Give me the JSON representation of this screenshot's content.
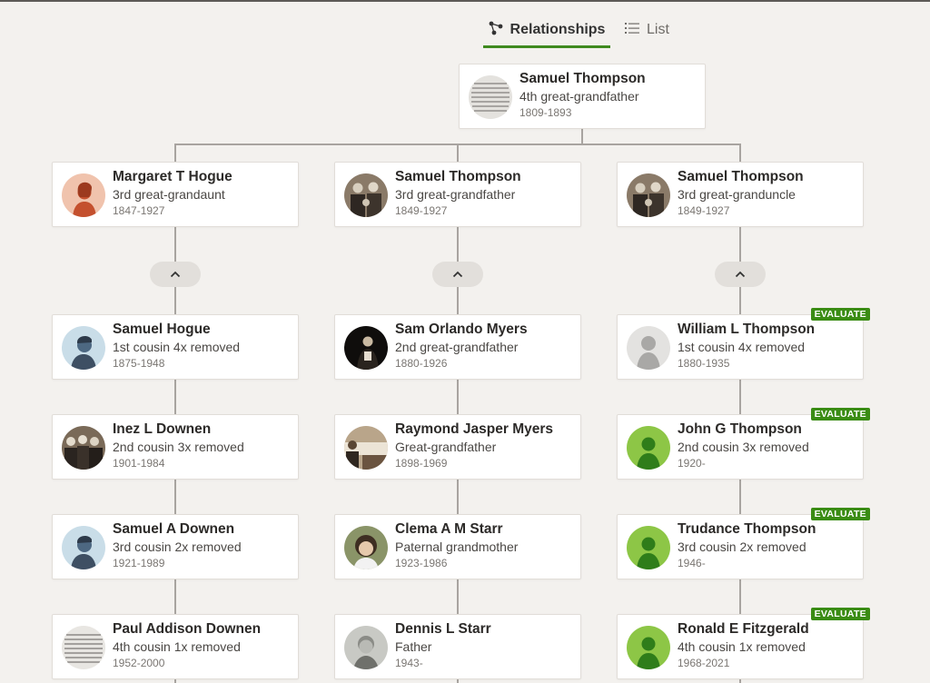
{
  "tabs": {
    "relationships": "Relationships",
    "list": "List"
  },
  "colors": {
    "accent": "#3f8a1f",
    "badge": "#3a8c14"
  },
  "badge_label": "EVALUATE",
  "root": {
    "name": "Samuel Thompson",
    "relation": "4th great-grandfather",
    "dates": "1809-1893",
    "avatar": "document-photo"
  },
  "col1": [
    {
      "name": "Margaret T Hogue",
      "relation": "3rd great-grandaunt",
      "dates": "1847-1927",
      "avatar": "woman-illustration-icon"
    },
    {
      "name": "Samuel Hogue",
      "relation": "1st cousin 4x removed",
      "dates": "1875-1948",
      "avatar": "man-illustration-icon"
    },
    {
      "name": "Inez L Downen",
      "relation": "2nd cousin 3x removed",
      "dates": "1901-1984",
      "avatar": "group-photo"
    },
    {
      "name": "Samuel A Downen",
      "relation": "3rd cousin 2x removed",
      "dates": "1921-1989",
      "avatar": "man-illustration-icon"
    },
    {
      "name": "Paul Addison Downen",
      "relation": "4th cousin 1x removed",
      "dates": "1952-2000",
      "avatar": "document-photo"
    }
  ],
  "col2": [
    {
      "name": "Samuel Thompson",
      "relation": "3rd great-grandfather",
      "dates": "1849-1927",
      "avatar": "family-photo"
    },
    {
      "name": "Sam Orlando Myers",
      "relation": "2nd great-grandfather",
      "dates": "1880-1926",
      "avatar": "portrait-photo"
    },
    {
      "name": "Raymond Jasper Myers",
      "relation": "Great-grandfather",
      "dates": "1898-1969",
      "avatar": "group-photo"
    },
    {
      "name": "Clema A M Starr",
      "relation": "Paternal grandmother",
      "dates": "1923-1986",
      "avatar": "portrait-photo"
    },
    {
      "name": "Dennis L Starr",
      "relation": "Father",
      "dates": "1943-",
      "avatar": "portrait-photo"
    }
  ],
  "col3": [
    {
      "name": "Samuel Thompson",
      "relation": "3rd great-granduncle",
      "dates": "1849-1927",
      "avatar": "family-photo"
    },
    {
      "name": "William L Thompson",
      "relation": "1st cousin 4x removed",
      "dates": "1880-1935",
      "avatar": "silhouette-icon",
      "badge": true
    },
    {
      "name": "John G Thompson",
      "relation": "2nd cousin 3x removed",
      "dates": "1920-",
      "avatar": "green-silhouette-icon",
      "badge": true
    },
    {
      "name": "Trudance Thompson",
      "relation": "3rd cousin 2x removed",
      "dates": "1946-",
      "avatar": "green-silhouette-icon",
      "badge": true
    },
    {
      "name": "Ronald E Fitzgerald",
      "relation": "4th cousin 1x removed",
      "dates": "1968-2021",
      "avatar": "green-silhouette-icon",
      "badge": true
    }
  ]
}
